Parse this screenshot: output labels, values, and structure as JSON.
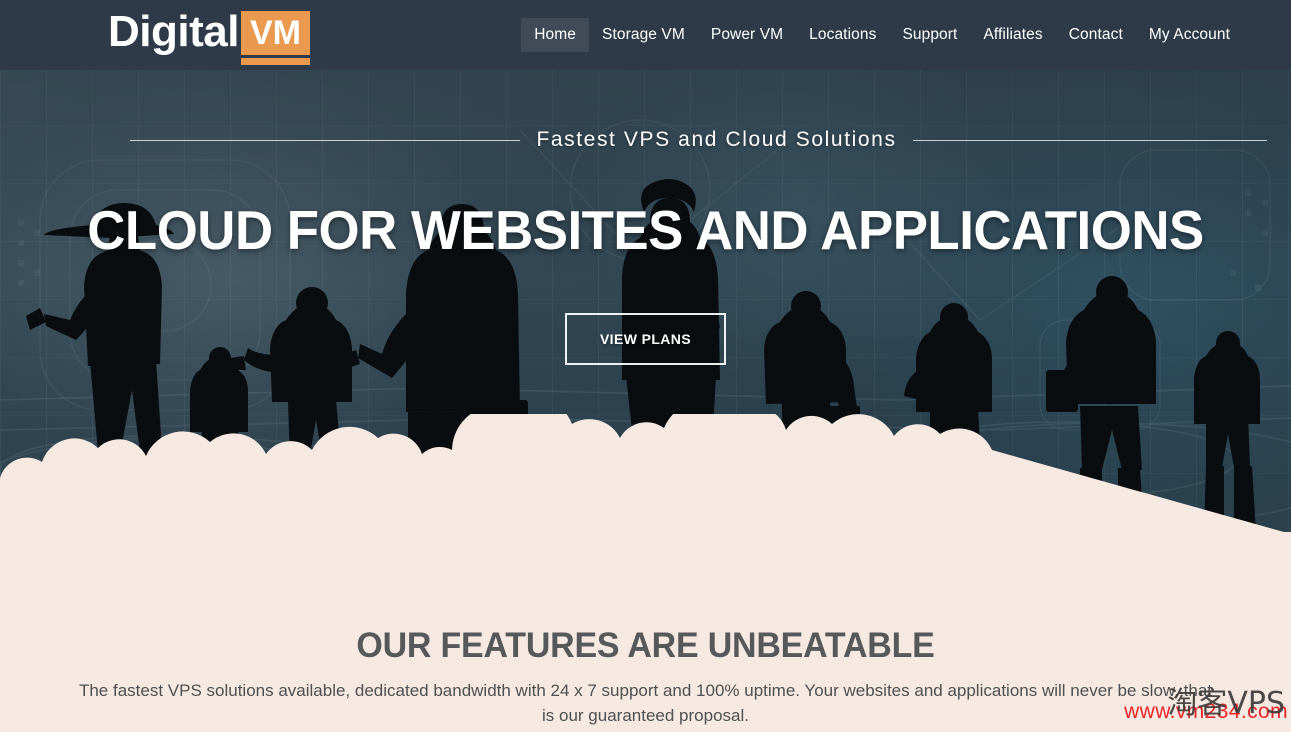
{
  "header": {
    "logo": {
      "word": "Digital",
      "badge": "VM"
    },
    "nav": [
      {
        "label": "Home",
        "active": true
      },
      {
        "label": "Storage VM",
        "active": false
      },
      {
        "label": "Power VM",
        "active": false
      },
      {
        "label": "Locations",
        "active": false
      },
      {
        "label": "Support",
        "active": false
      },
      {
        "label": "Affiliates",
        "active": false
      },
      {
        "label": "Contact",
        "active": false
      },
      {
        "label": "My Account",
        "active": false
      }
    ],
    "background_color": "#2E3A47",
    "accent_color": "#E99A4F"
  },
  "hero": {
    "tagline": "Fastest VPS and Cloud Solutions",
    "title": "CLOUD FOR WEBSITES AND APPLICATIONS",
    "cta_label": "VIEW PLANS",
    "background_color": "#3C5560"
  },
  "features": {
    "title": "OUR FEATURES ARE UNBEATABLE",
    "description": "The fastest VPS solutions available, dedicated bandwidth with 24 x 7 support and 100% uptime. Your websites and applications will never be slow, that is our guaranteed proposal.",
    "background_color": "#F6E9E1"
  },
  "watermark": {
    "url_text": "www.vm234.com",
    "brand_text": "淘客VPS",
    "url_color": "#E8262B"
  }
}
